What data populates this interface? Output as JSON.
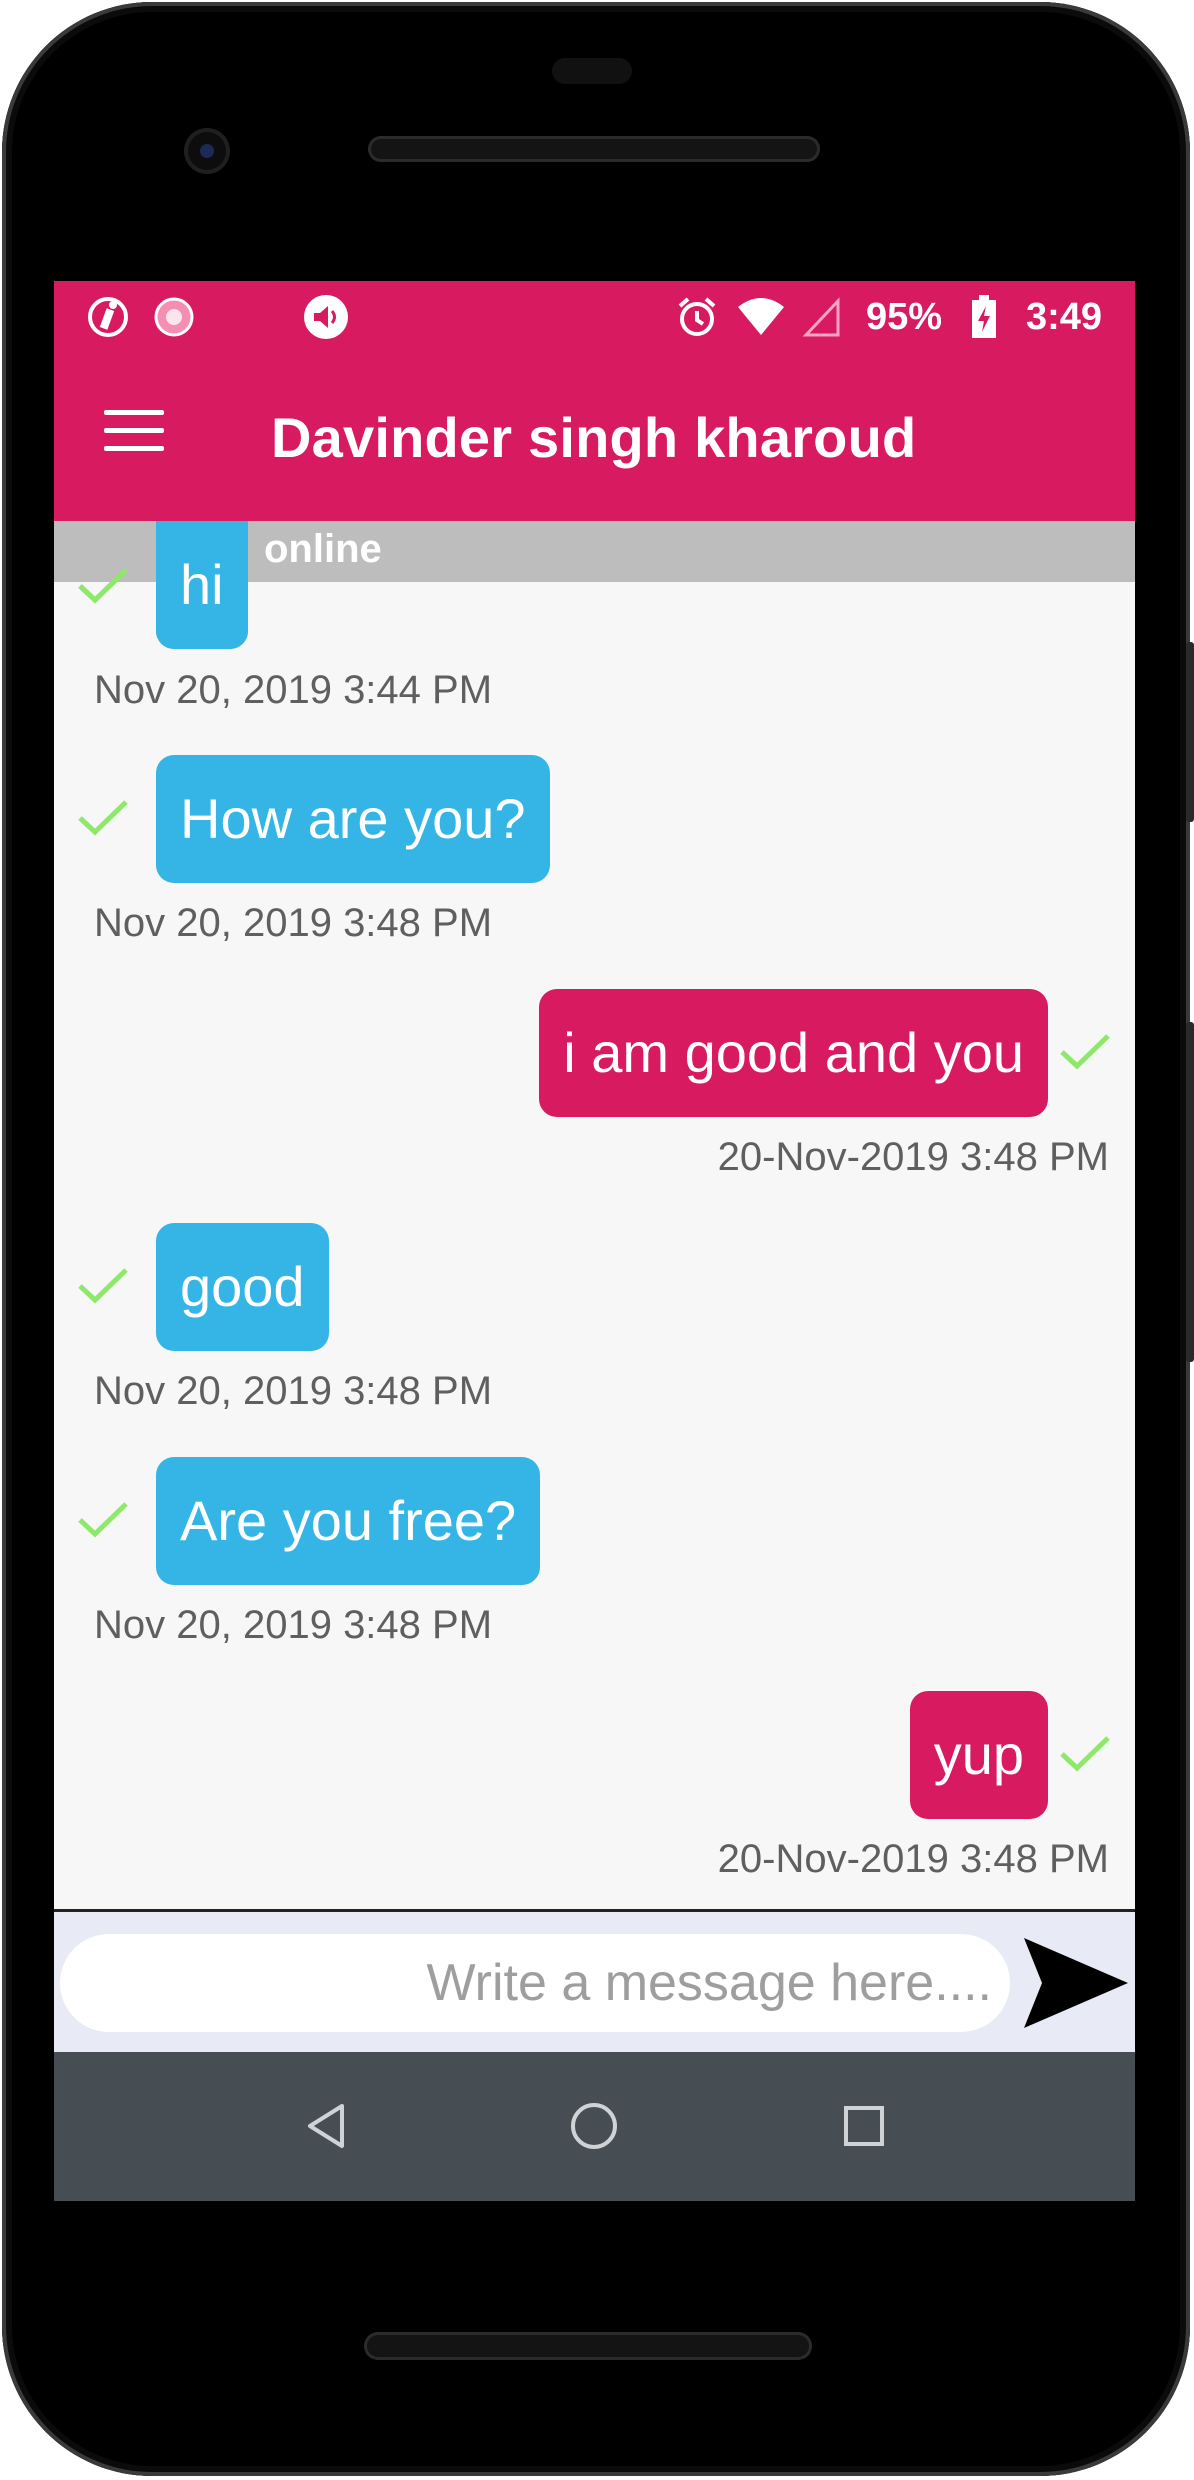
{
  "status_bar": {
    "battery_text": "95%",
    "time": "3:49"
  },
  "app_bar": {
    "menu_icon": "hamburger-menu-icon",
    "contact_name": "Davinder singh kharoud"
  },
  "presence": {
    "status_text": "online"
  },
  "colors": {
    "accent": "#d81b60",
    "incoming_bubble": "#35b5e5",
    "outgoing_bubble": "#d81b60",
    "read_check": "#8ee86a",
    "nav_bar": "#474e53"
  },
  "messages": [
    {
      "direction": "incoming",
      "text": "hi",
      "time": "Nov 20, 2019 3:44 PM"
    },
    {
      "direction": "incoming",
      "text": "How are you?",
      "time": "Nov 20, 2019 3:48 PM"
    },
    {
      "direction": "outgoing",
      "text": "i am good and you",
      "time": "20-Nov-2019 3:48 PM"
    },
    {
      "direction": "incoming",
      "text": "good",
      "time": "Nov 20, 2019 3:48 PM"
    },
    {
      "direction": "incoming",
      "text": "Are you free?",
      "time": "Nov 20, 2019 3:48 PM"
    },
    {
      "direction": "outgoing",
      "text": "yup",
      "time": "20-Nov-2019 3:48 PM"
    }
  ],
  "composer": {
    "placeholder": "Write a message here....",
    "value": "",
    "send_icon": "send-arrow-icon"
  },
  "nav_bar": {
    "back_icon": "back-triangle-icon",
    "home_icon": "home-circle-icon",
    "recents_icon": "recents-square-icon"
  }
}
